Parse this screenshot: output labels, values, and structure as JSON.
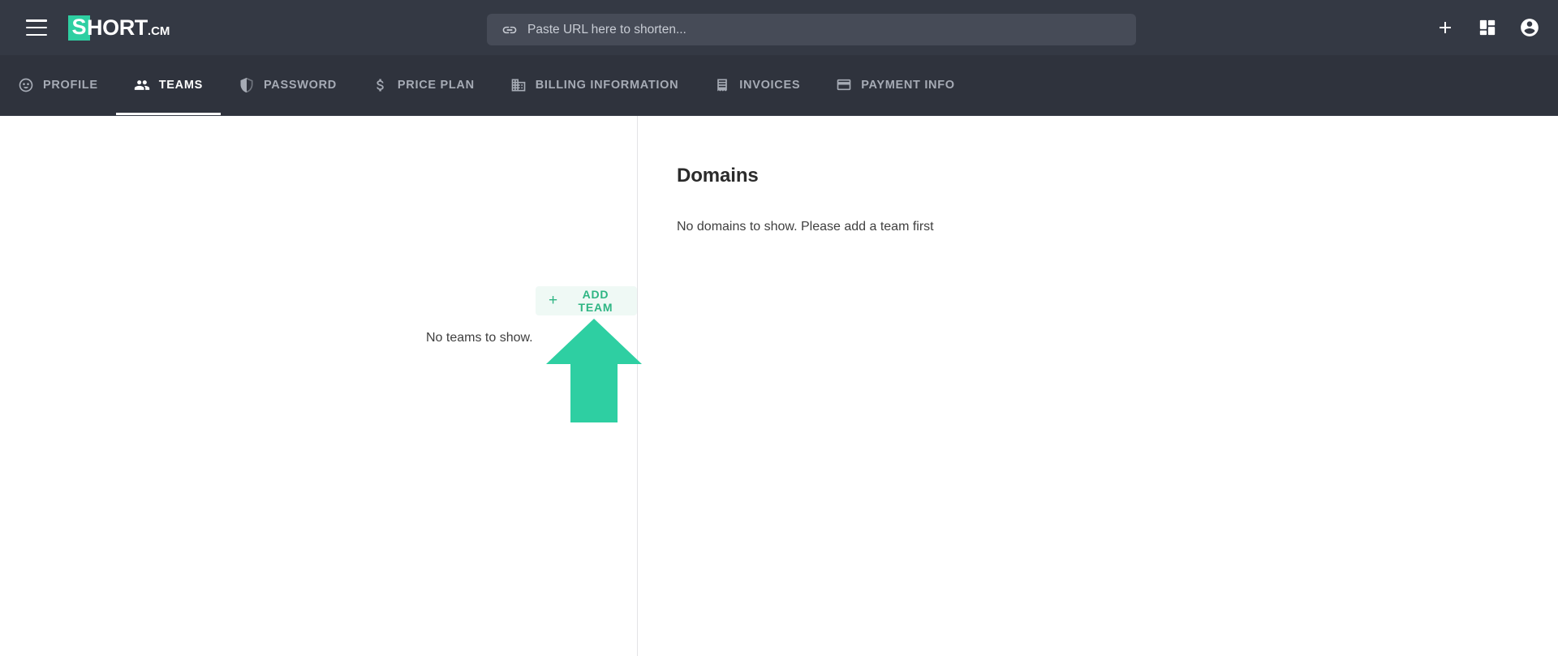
{
  "header": {
    "menu_icon": "hamburger-menu-icon",
    "logo": {
      "mark": "S",
      "name": "HORT",
      "tld": ".CM"
    },
    "search": {
      "icon": "link-icon",
      "value": "",
      "placeholder": "Paste URL here to shorten..."
    },
    "actions": [
      {
        "name": "add-button",
        "icon": "plus-icon"
      },
      {
        "name": "dashboard-button",
        "icon": "grid-icon"
      },
      {
        "name": "account-button",
        "icon": "account-circle-icon"
      }
    ]
  },
  "tabs": [
    {
      "label": "PROFILE",
      "icon": "profile-face-icon",
      "active": false
    },
    {
      "label": "TEAMS",
      "icon": "people-icon",
      "active": true
    },
    {
      "label": "PASSWORD",
      "icon": "shield-icon",
      "active": false
    },
    {
      "label": "PRICE PLAN",
      "icon": "dollar-icon",
      "active": false
    },
    {
      "label": "BILLING INFORMATION",
      "icon": "building-icon",
      "active": false
    },
    {
      "label": "INVOICES",
      "icon": "receipt-icon",
      "active": false
    },
    {
      "label": "PAYMENT INFO",
      "icon": "credit-card-icon",
      "active": false
    }
  ],
  "main": {
    "teams": {
      "add_team_label": "ADD TEAM",
      "add_team_plus": "+",
      "empty_text": "No teams to show."
    },
    "domains": {
      "title": "Domains",
      "empty_text": "No domains to show. Please add a team first"
    },
    "annotation": {
      "name": "up-arrow-annotation",
      "color": "#2ecfa2"
    }
  },
  "colors": {
    "header_bg": "#343944",
    "tabbar_bg": "#2f333d",
    "search_bg": "#464b57",
    "accent_green": "#2ecfa2",
    "button_green": "#2eb583",
    "button_bg": "#eff9f5"
  }
}
